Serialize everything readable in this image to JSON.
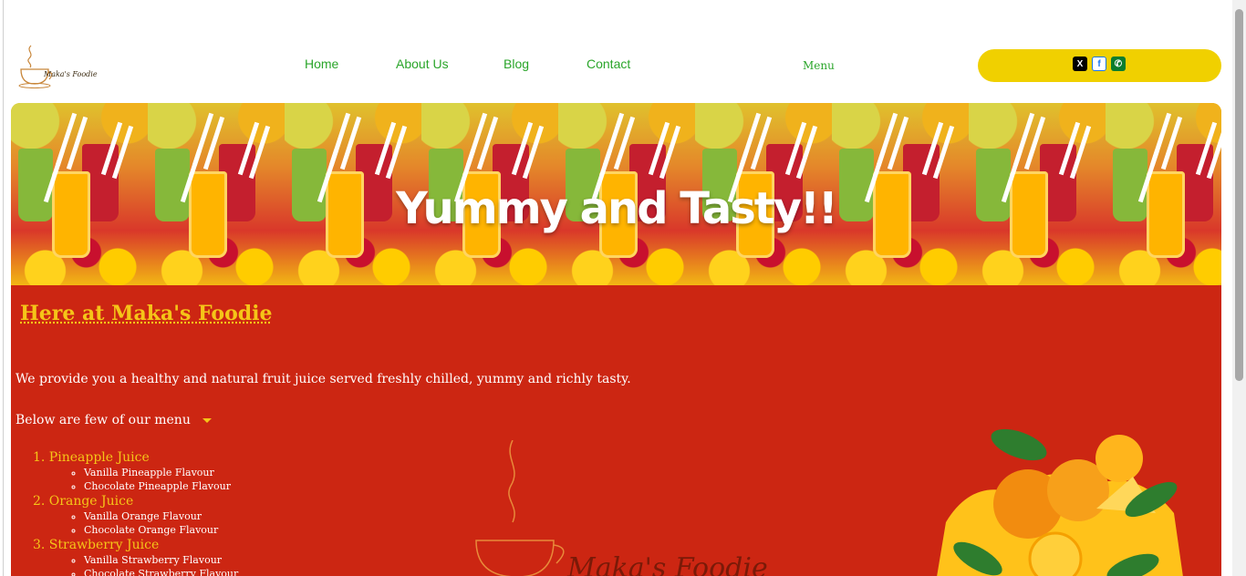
{
  "brand": {
    "logo_text": "Maka's Foodie"
  },
  "nav": {
    "items": [
      {
        "label": "Home"
      },
      {
        "label": "About Us"
      },
      {
        "label": "Blog"
      },
      {
        "label": "Contact"
      }
    ],
    "menu_label": "Menu"
  },
  "social": {
    "icons": [
      "x-icon",
      "facebook-icon",
      "whatsapp-icon"
    ],
    "x_glyph": "X",
    "fb_glyph": "f",
    "wa_glyph": "✆"
  },
  "hero": {
    "title": "Yummy and Tasty!!"
  },
  "content": {
    "heading": "Here at Maka's Foodie",
    "intro": "We provide you a healthy and natural fruit juice served freshly chilled, yummy and richly tasty.",
    "summary": "Below are few of our menu",
    "menu": [
      {
        "name": "1. Pineapple Juice",
        "flavours": [
          "Vanilla Pineapple Flavour",
          "Chocolate Pineapple Flavour"
        ]
      },
      {
        "name": "2. Orange Juice",
        "flavours": [
          "Vanilla Orange Flavour",
          "Chocolate Orange Flavour"
        ]
      },
      {
        "name": "3. Strawberry Juice",
        "flavours": [
          "Vanilla Strawberry Flavour",
          "Chocolate Strawberry Flavour"
        ]
      }
    ],
    "watermark_text": "Maka's Foodie"
  },
  "colors": {
    "nav_green": "#2aa52a",
    "social_bar": "#f0d000",
    "content_red": "#cc2612",
    "heading_gold": "#f5c518"
  }
}
